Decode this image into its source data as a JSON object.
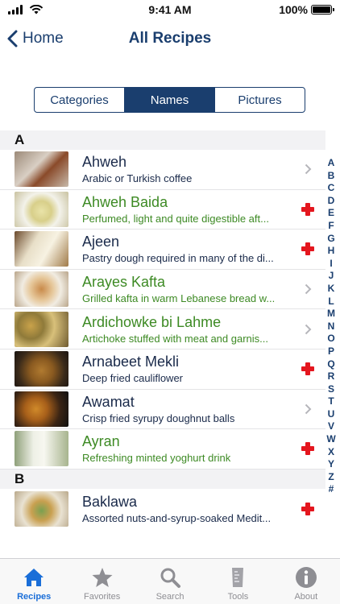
{
  "status_bar": {
    "time": "9:41 AM",
    "battery": "100%"
  },
  "nav": {
    "back_label": "Home",
    "title": "All Recipes"
  },
  "segments": [
    {
      "label": "Categories",
      "active": false
    },
    {
      "label": "Names",
      "active": true
    },
    {
      "label": "Pictures",
      "active": false
    }
  ],
  "sections": [
    {
      "letter": "A",
      "rows": [
        {
          "title": "Ahweh",
          "subtitle": "Arabic or Turkish coffee",
          "style": "normal",
          "accessory": "chevron"
        },
        {
          "title": "Ahweh Baida",
          "subtitle": "Perfumed, light and quite digestible aft...",
          "style": "green",
          "accessory": "plus"
        },
        {
          "title": "Ajeen",
          "subtitle": "Pastry dough required in many of the di...",
          "style": "normal",
          "accessory": "plus"
        },
        {
          "title": "Arayes Kafta",
          "subtitle": "Grilled kafta in warm Lebanese bread w...",
          "style": "green",
          "accessory": "chevron"
        },
        {
          "title": "Ardichowke bi Lahme",
          "subtitle": "Artichoke stuffed with meat and garnis...",
          "style": "green",
          "accessory": "chevron"
        },
        {
          "title": "Arnabeet Mekli",
          "subtitle": "Deep fried cauliflower",
          "style": "normal",
          "accessory": "plus"
        },
        {
          "title": "Awamat",
          "subtitle": "Crisp fried syrupy doughnut balls",
          "style": "normal",
          "accessory": "chevron"
        },
        {
          "title": "Ayran",
          "subtitle": "Refreshing minted yoghurt drink",
          "style": "green",
          "accessory": "plus"
        }
      ]
    },
    {
      "letter": "B",
      "rows": [
        {
          "title": "Baklawa",
          "subtitle": "Assorted nuts-and-syrup-soaked Medit...",
          "style": "normal",
          "accessory": "plus"
        }
      ]
    }
  ],
  "index_letters": [
    "A",
    "B",
    "C",
    "D",
    "E",
    "F",
    "G",
    "H",
    "I",
    "J",
    "K",
    "L",
    "M",
    "N",
    "O",
    "P",
    "Q",
    "R",
    "S",
    "T",
    "U",
    "V",
    "W",
    "X",
    "Y",
    "Z",
    "#"
  ],
  "tabs": [
    {
      "label": "Recipes",
      "icon": "house-icon",
      "active": true
    },
    {
      "label": "Favorites",
      "icon": "star-icon",
      "active": false
    },
    {
      "label": "Search",
      "icon": "magnifier-icon",
      "active": false
    },
    {
      "label": "Tools",
      "icon": "measuring-cup-icon",
      "active": false
    },
    {
      "label": "About",
      "icon": "info-icon",
      "active": false
    }
  ],
  "colors": {
    "navy": "#1a3e6e",
    "green_text": "#3d8a24",
    "plus_red": "#e4161e",
    "tab_active": "#1a6ed8",
    "tab_inactive": "#8e8e93"
  }
}
